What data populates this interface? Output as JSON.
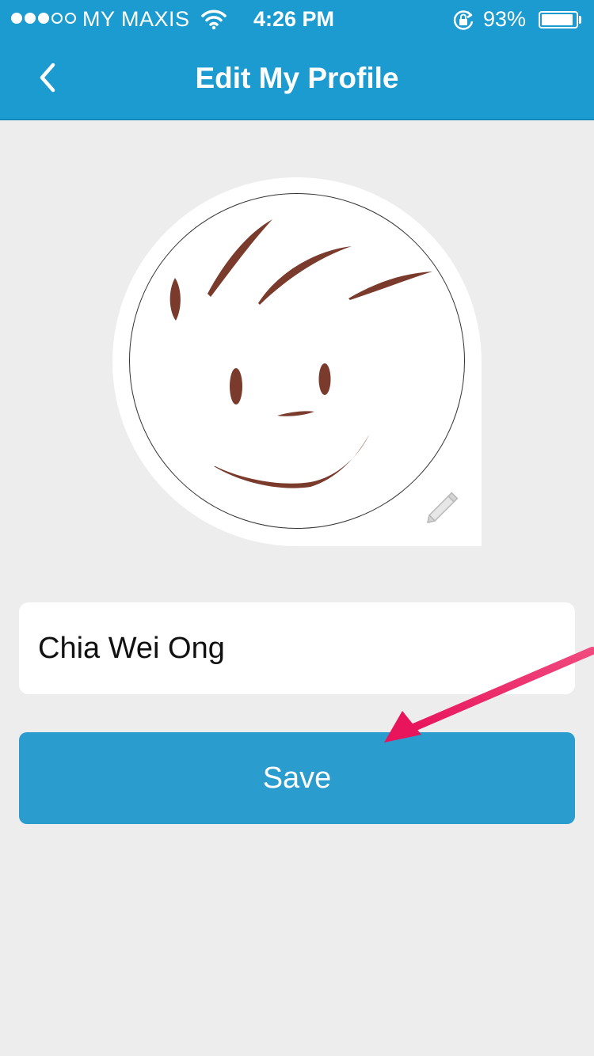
{
  "status_bar": {
    "carrier": "MY MAXIS",
    "time": "4:26 PM",
    "battery_percent": "93%",
    "battery_level": 0.93,
    "signal_bars_filled": 3,
    "signal_bars_total": 5,
    "icons": [
      "wifi-icon",
      "rotation-lock-icon",
      "battery-icon"
    ]
  },
  "nav": {
    "title": "Edit My Profile",
    "back_icon": "chevron-left-icon"
  },
  "profile": {
    "avatar_icon": "cartoon-face-avatar",
    "edit_icon": "pencil-icon",
    "name_value": "Chia Wei Ong"
  },
  "actions": {
    "save_label": "Save"
  },
  "colors": {
    "header": "#1b9bd0",
    "save_button": "#2a9ccd",
    "background": "#ededed",
    "avatar_strokes": "#7a3a2c",
    "annotation_arrow": "#ef2f6f"
  }
}
